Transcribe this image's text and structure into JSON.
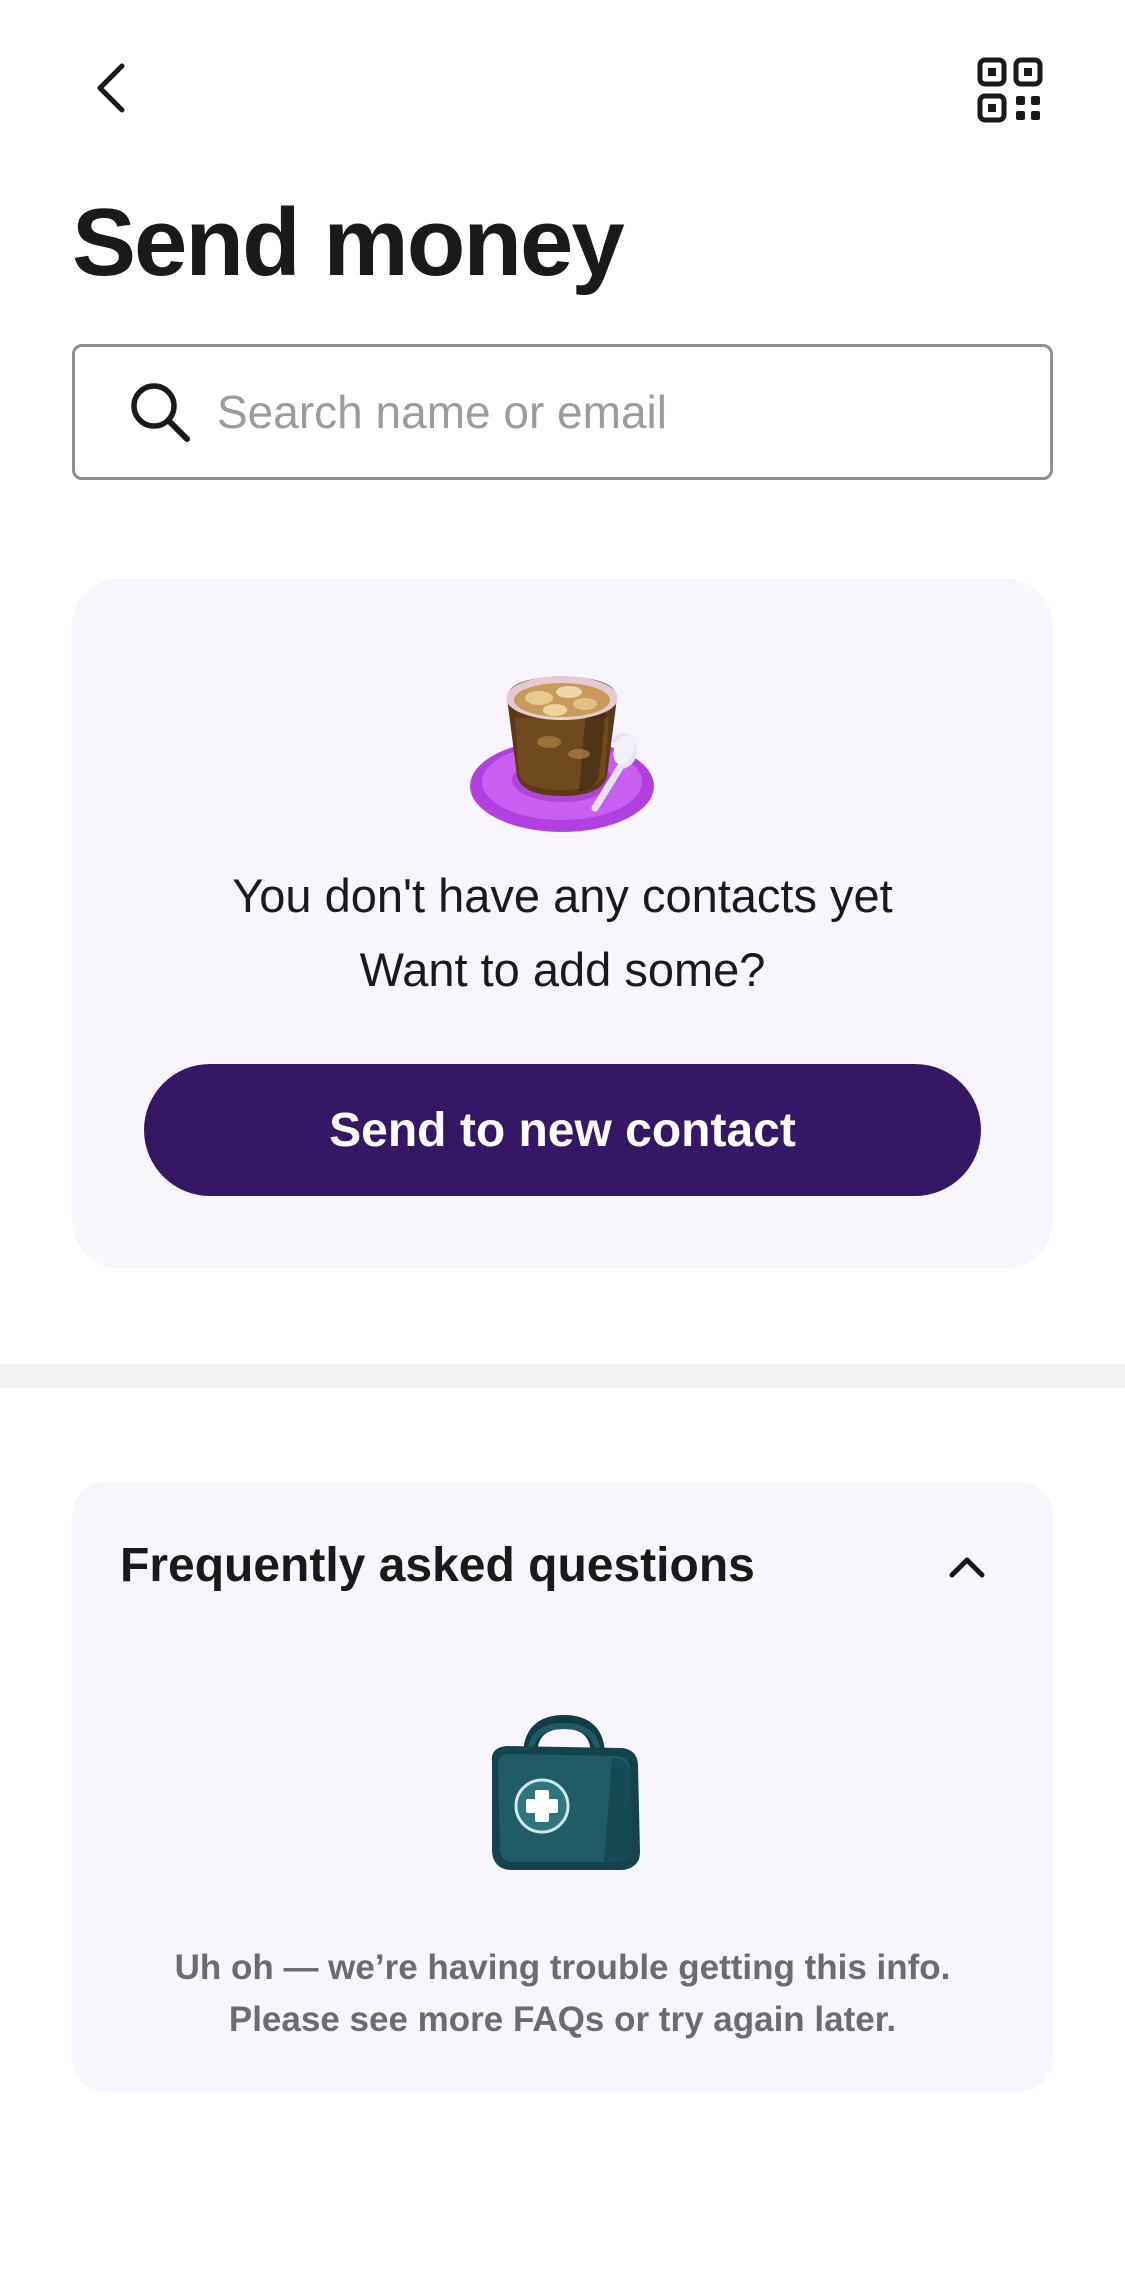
{
  "header": {
    "back_icon": "chevron-left-icon",
    "qr_icon": "qr-code-icon",
    "title": "Send money"
  },
  "search": {
    "icon": "search-icon",
    "placeholder": "Search name or email",
    "value": ""
  },
  "contacts": {
    "illustration": "coffee-cup-illustration",
    "empty_line1": "You don't have any contacts yet",
    "empty_line2": "Want to add some?",
    "send_new_label": "Send to new contact"
  },
  "faq": {
    "title": "Frequently asked questions",
    "toggle_icon": "chevron-up-icon",
    "illustration": "first-aid-kit-illustration",
    "error_line1": "Uh oh — we’re having trouble getting this info.",
    "error_line2": "Please see more FAQs or try again later."
  },
  "colors": {
    "accent": "#351766",
    "card_bg": "#f8f5fd",
    "text": "#1a1a1a",
    "muted": "#6b6b73"
  }
}
